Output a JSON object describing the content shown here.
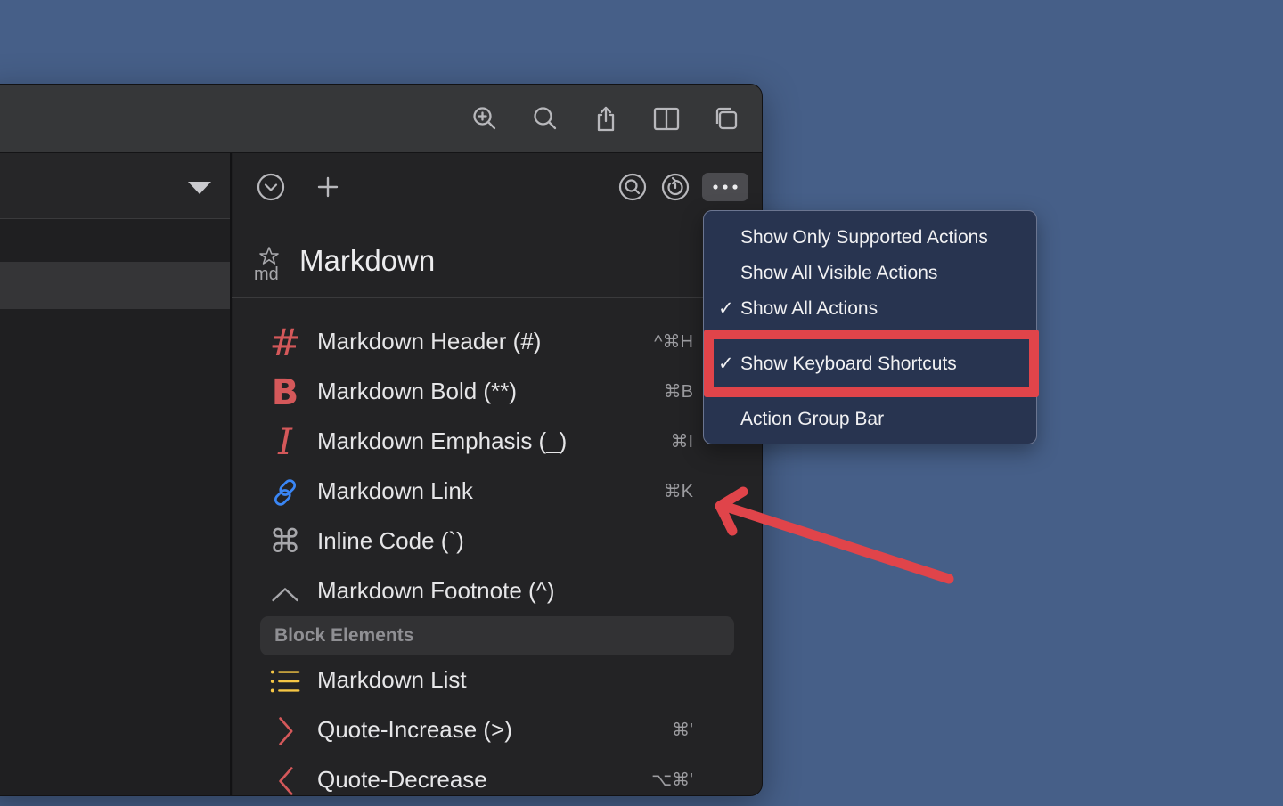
{
  "titlebar": {
    "icons": [
      "zoom-in-icon",
      "search-icon",
      "share-icon",
      "sidebar-toggle-icon",
      "window-copy-icon"
    ]
  },
  "action_pane": {
    "toolbar_icons": [
      "chevron-circle-down-icon",
      "plus-icon",
      "search-circle-icon",
      "history-icon",
      "more-icon"
    ],
    "title": "Markdown",
    "actions": [
      {
        "label": "Markdown Header (#)",
        "shortcut": "^⌘H",
        "icon": "hash-icon",
        "color": "#d4585a"
      },
      {
        "label": "Markdown Bold (**)",
        "shortcut": "⌘B",
        "icon": "bold-icon",
        "color": "#d4585a"
      },
      {
        "label": "Markdown Emphasis (_)",
        "shortcut": "⌘I",
        "icon": "italic-icon",
        "color": "#d4585a"
      },
      {
        "label": "Markdown Link",
        "shortcut": "⌘K",
        "icon": "link-icon",
        "color": "#3a86f5"
      },
      {
        "label": "Inline Code (`)",
        "shortcut": "",
        "icon": "command-icon",
        "color": "#a7a7ab"
      },
      {
        "label": "Markdown Footnote (^)",
        "shortcut": "",
        "icon": "caret-icon",
        "color": "#a7a7ab"
      }
    ],
    "section_header": "Block Elements",
    "block_actions": [
      {
        "label": "Markdown List",
        "shortcut": "",
        "icon": "list-icon",
        "color": "#f5c645"
      },
      {
        "label": "Quote-Increase (>)",
        "shortcut": "⌘'",
        "icon": "chevron-right-icon",
        "color": "#d4585a"
      },
      {
        "label": "Quote-Decrease",
        "shortcut": "⌥⌘'",
        "icon": "chevron-left-icon",
        "color": "#d4585a"
      }
    ]
  },
  "menu": {
    "items": [
      {
        "label": "Show Only Supported Actions",
        "checked": false
      },
      {
        "label": "Show All Visible Actions",
        "checked": false
      },
      {
        "label": "Show All Actions",
        "checked": true
      },
      {
        "label": "Show Keyboard Shortcuts",
        "checked": true
      },
      {
        "label": "Action Group Bar",
        "checked": false
      }
    ],
    "checkmark": "✓"
  },
  "colors": {
    "background": "#465f88",
    "annotation_red": "#e0444a",
    "menu_bg": "#283450"
  }
}
